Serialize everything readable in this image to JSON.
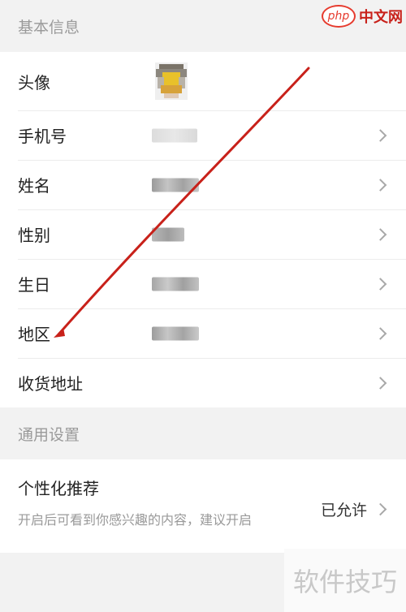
{
  "sections": {
    "basic_header": "基本信息",
    "general_header": "通用设置"
  },
  "rows": {
    "avatar": "头像",
    "phone": "手机号",
    "name": "姓名",
    "gender": "性别",
    "birthday": "生日",
    "region": "地区",
    "address": "收货地址"
  },
  "preference": {
    "title": "个性化推荐",
    "description": "开启后可看到你感兴趣的内容，建议开启",
    "status": "已允许"
  },
  "watermarks": {
    "php_badge": "php",
    "php_site": "中文网",
    "bottom": "软件技巧"
  },
  "colors": {
    "background": "#f2f2f2",
    "card": "#ffffff",
    "annotation_arrow": "#c8211a"
  },
  "icons": {
    "chevron": "chevron-right-icon"
  }
}
